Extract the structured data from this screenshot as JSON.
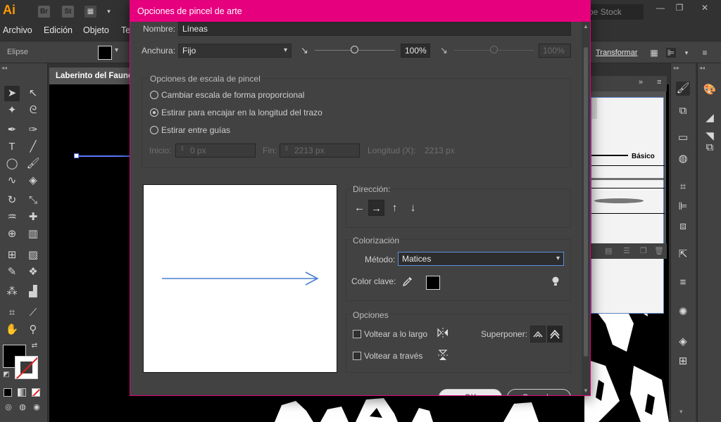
{
  "appbar": {
    "logo": "Ai",
    "bridge": "Br",
    "stock": "St",
    "search_placeholder": "be Stock"
  },
  "menubar": {
    "items": [
      "Archivo",
      "Edición",
      "Objeto",
      "Te"
    ]
  },
  "ctrlbar": {
    "tool_label": "Elipse",
    "transform_label": "Transformar"
  },
  "document": {
    "tab_title": "Laberinto del Fauno"
  },
  "brushes_panel": {
    "basic_label": "Básico"
  },
  "dialog": {
    "title": "Opciones de pincel de arte",
    "name_label": "Nombre:",
    "name_value": "Líneas",
    "width_label": "Anchura:",
    "width_mode": "Fijo",
    "width_percent": "100%",
    "width_percent_max": "100%",
    "scale_group_title": "Opciones de escala de pincel",
    "scale_options": [
      {
        "label": "Cambiar escala de forma proporcional",
        "checked": false
      },
      {
        "label": "Estirar para encajar en la longitud del trazo",
        "checked": true
      },
      {
        "label": "Estirar entre guías",
        "checked": false
      }
    ],
    "guides": {
      "start_label": "Inicio:",
      "start_value": "0 px",
      "end_label": "Fin:",
      "end_value": "2213 px",
      "length_label": "Longitud (X):",
      "length_value": "2213 px"
    },
    "direction_title": "Dirección:",
    "direction_buttons": [
      "←",
      "→",
      "↑",
      "↓"
    ],
    "direction_selected": 1,
    "colorization_title": "Colorización",
    "method_label": "Método:",
    "method_value": "Matices",
    "key_color_label": "Color clave:",
    "key_color": "#000000",
    "options_title": "Opciones",
    "flip_along_label": "Voltear a lo largo",
    "flip_across_label": "Voltear a través",
    "overlap_label": "Superponer:",
    "ok_label": "OK",
    "cancel_label": "Cancelar"
  },
  "colors": {
    "accent": "#e6007e",
    "selection": "#5a78ff",
    "preview_arrow": "#4a7fd0"
  }
}
